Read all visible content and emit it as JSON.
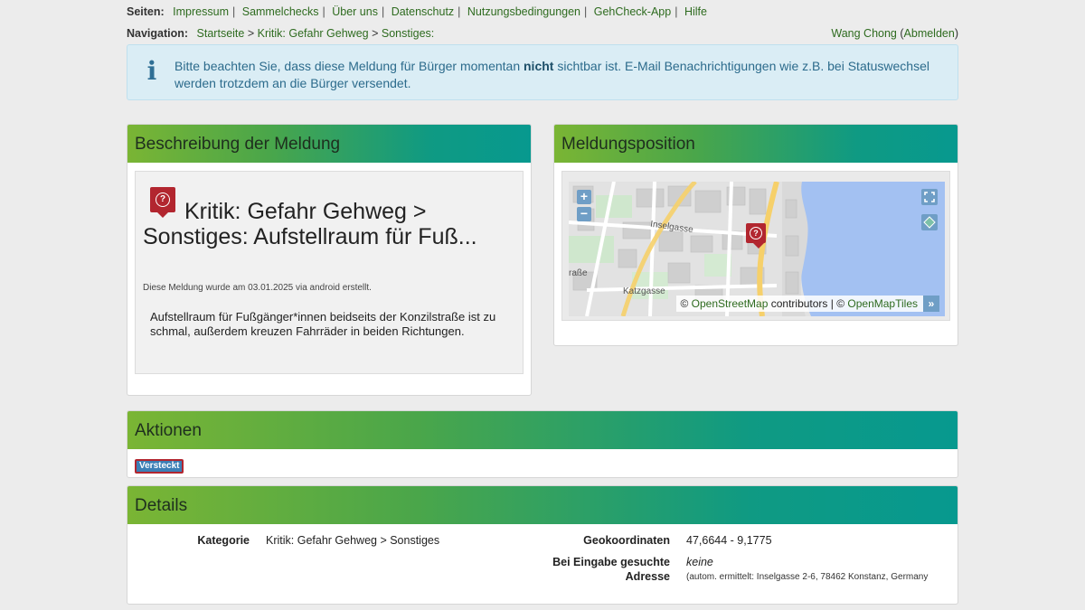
{
  "top": {
    "pages_label": "Seiten:",
    "links": [
      "Impressum",
      "Sammelchecks",
      "Über uns",
      "Datenschutz",
      "Nutzungsbedingungen",
      "GehCheck-App",
      "Hilfe"
    ]
  },
  "navigation": {
    "label": "Navigation:",
    "crumbs": [
      "Startseite",
      "Kritik: Gefahr Gehweg",
      "Sonstiges:"
    ],
    "user": "Wang Chong",
    "logout": "Abmelden"
  },
  "notice": {
    "before": "Bitte beachten Sie, dass diese Meldung für Bürger momentan ",
    "bold": "nicht",
    "after": " sichtbar ist. E-Mail Benachrichtigungen wie z.B. bei Statuswechsel werden trotzdem an die Bürger versendet."
  },
  "description": {
    "heading": "Beschreibung der Meldung",
    "title": "Kritik: Gefahr Gehweg > Sonstiges: Aufstellraum für Fuß...",
    "created": "Diese Meldung wurde am 03.01.2025 via android erstellt.",
    "text": "Aufstellraum für Fußgänger*innen beidseits der Konzilstraße ist zu schmal, außerdem kreuzen Fahrräder in beiden Richtungen."
  },
  "map": {
    "heading": "Meldungsposition",
    "zoom_in": "+",
    "zoom_out": "−",
    "attribution_osm": "OpenStreetMap",
    "attribution_contrib": "contributors",
    "attribution_tiles": "OpenMapTiles",
    "more": "»",
    "street_labels": [
      "Inselgasse",
      "Katzgasse",
      "raße",
      "raße"
    ]
  },
  "actions": {
    "heading": "Aktionen",
    "badge": "Versteckt"
  },
  "details": {
    "heading": "Details",
    "category_label": "Kategorie",
    "category_value": "Kritik: Gefahr Gehweg > Sonstiges",
    "geo_label": "Geokoordinaten",
    "geo_value": "47,6644 - 9,1775",
    "address_label_1": "Bei Eingabe gesuchte",
    "address_label_2": "Adresse",
    "address_value": "keine",
    "address_auto": "(autom. ermittelt: Inselgasse 2-6, 78462 Konstanz, Germany"
  },
  "colors": {
    "link": "#2e6b1f",
    "info_bg": "#daedf5",
    "marker": "#b2262f",
    "header_gradient_start": "#7ab534",
    "header_gradient_end": "#07998f",
    "water": "#a3c1f2"
  }
}
